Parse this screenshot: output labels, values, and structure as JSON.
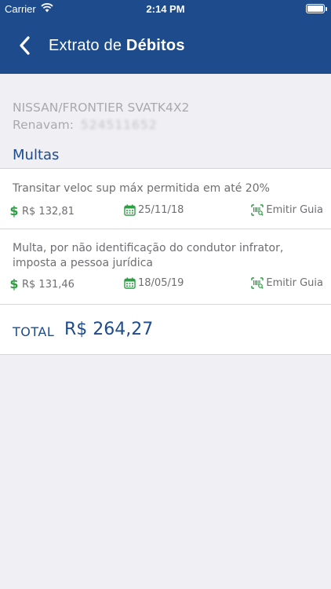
{
  "status_bar": {
    "carrier": "Carrier",
    "time": "2:14 PM"
  },
  "nav": {
    "title_prefix": "Extrato de ",
    "title_bold": "Débitos"
  },
  "vehicle": {
    "model": "NISSAN/FRONTIER SVATK4X2",
    "renavam_label": "Renavam:",
    "renavam_value": "524511652"
  },
  "section": {
    "title": "Multas"
  },
  "fines": [
    {
      "description": "Transitar veloc sup máx permitida em até 20%",
      "amount": "R$ 132,81",
      "date": "25/11/18",
      "action": "Emitir Guia"
    },
    {
      "description": "Multa, por não identificação do condutor infrator, imposta a pessoa jurídica",
      "amount": "R$ 131,46",
      "date": "18/05/19",
      "action": "Emitir Guia"
    }
  ],
  "total": {
    "label": "TOTAL",
    "value": "R$ 264,27"
  },
  "icons": {
    "dollar": "$",
    "calendar": "calendar-icon",
    "barcode": "barcode-icon"
  },
  "colors": {
    "primary": "#1e4b8c",
    "green": "#2e9e45",
    "background": "#efeff4"
  }
}
